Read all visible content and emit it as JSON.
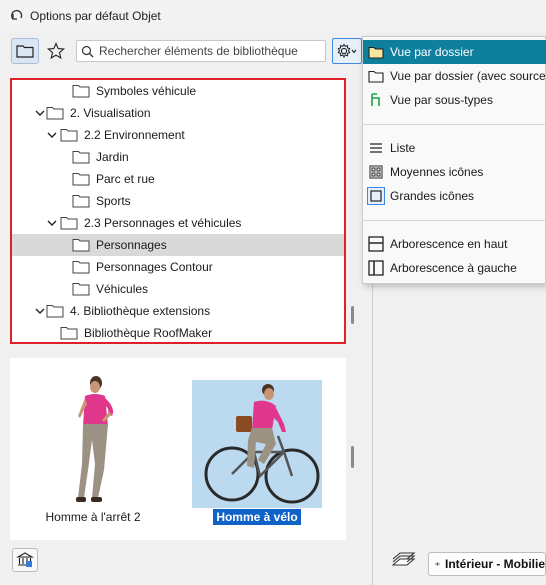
{
  "window": {
    "title": "Options par défaut Objet"
  },
  "search": {
    "placeholder": "Rechercher éléments de bibliothèque"
  },
  "tree": {
    "items": [
      {
        "label": "Symboles véhicule",
        "level": 3,
        "expanded": null
      },
      {
        "label": "2. Visualisation",
        "level": 1,
        "expanded": true
      },
      {
        "label": "2.2 Environnement",
        "level": 2,
        "expanded": true
      },
      {
        "label": "Jardin",
        "level": 3,
        "expanded": null
      },
      {
        "label": "Parc et rue",
        "level": 3,
        "expanded": null
      },
      {
        "label": "Sports",
        "level": 3,
        "expanded": null
      },
      {
        "label": "2.3 Personnages et véhicules",
        "level": 2,
        "expanded": true
      },
      {
        "label": "Personnages",
        "level": 3,
        "expanded": null,
        "selected": true
      },
      {
        "label": "Personnages Contour",
        "level": 3,
        "expanded": null
      },
      {
        "label": "Véhicules",
        "level": 3,
        "expanded": null
      },
      {
        "label": "4. Bibliothèque extensions",
        "level": 1,
        "expanded": true
      },
      {
        "label": "Bibliothèque RoofMaker",
        "level": 2,
        "expanded": null
      }
    ]
  },
  "preview": {
    "items": [
      {
        "caption": "Homme à l'arrêt 2",
        "selected": false
      },
      {
        "caption": "Homme à vélo",
        "selected": true
      }
    ]
  },
  "view_menu": {
    "items": [
      {
        "label": "Vue par dossier",
        "icon": "folder-icon",
        "highlighted": true
      },
      {
        "label": "Vue par dossier (avec sources)",
        "icon": "folder-icon"
      },
      {
        "label": "Vue par sous-types",
        "icon": "subtypes-icon"
      },
      {
        "label": "Liste",
        "icon": "list-icon"
      },
      {
        "label": "Moyennes icônes",
        "icon": "medium-icons-icon"
      },
      {
        "label": "Grandes icônes",
        "icon": "large-icons-icon"
      },
      {
        "label": "Arborescence en haut",
        "icon": "tree-top-icon"
      },
      {
        "label": "Arborescence à gauche",
        "icon": "tree-left-icon"
      }
    ]
  },
  "bottom": {
    "view_label": "Intérieur - Mobilie"
  },
  "colors": {
    "highlight": "#0f7f9e",
    "selection": "#0f62c7",
    "red_frame": "#e01f26",
    "shirt": "#e0368c"
  }
}
